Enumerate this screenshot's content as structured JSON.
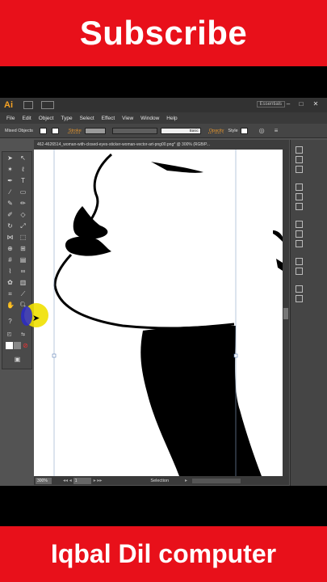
{
  "banners": {
    "top": "Subscribe",
    "bottom": "Iqbal Dil computer"
  },
  "app": {
    "logo": "Ai",
    "workspace": "Essentials",
    "window_controls": [
      "–",
      "□",
      "✕"
    ],
    "menu": [
      "File",
      "Edit",
      "Object",
      "Type",
      "Select",
      "Effect",
      "View",
      "Window",
      "Help"
    ],
    "control_bar": {
      "selection_label": "Mixed Objects",
      "stroke_label": "Stroke",
      "brush_label": "Basic",
      "opacity_label": "Opacity",
      "style_label": "Style"
    },
    "document_tab": "462-4626514_woman-with-closed-eyes-sticker-woman-vector-art-png00.png* @ 300% (RGB/P...",
    "status": {
      "zoom": "300%",
      "artboard": "1",
      "tool": "Selection"
    }
  },
  "colors": {
    "banner_red": "#e8101a",
    "cursor_highlight": "#f0e000",
    "app_bg": "#535353",
    "accent_orange": "#f7a324"
  }
}
